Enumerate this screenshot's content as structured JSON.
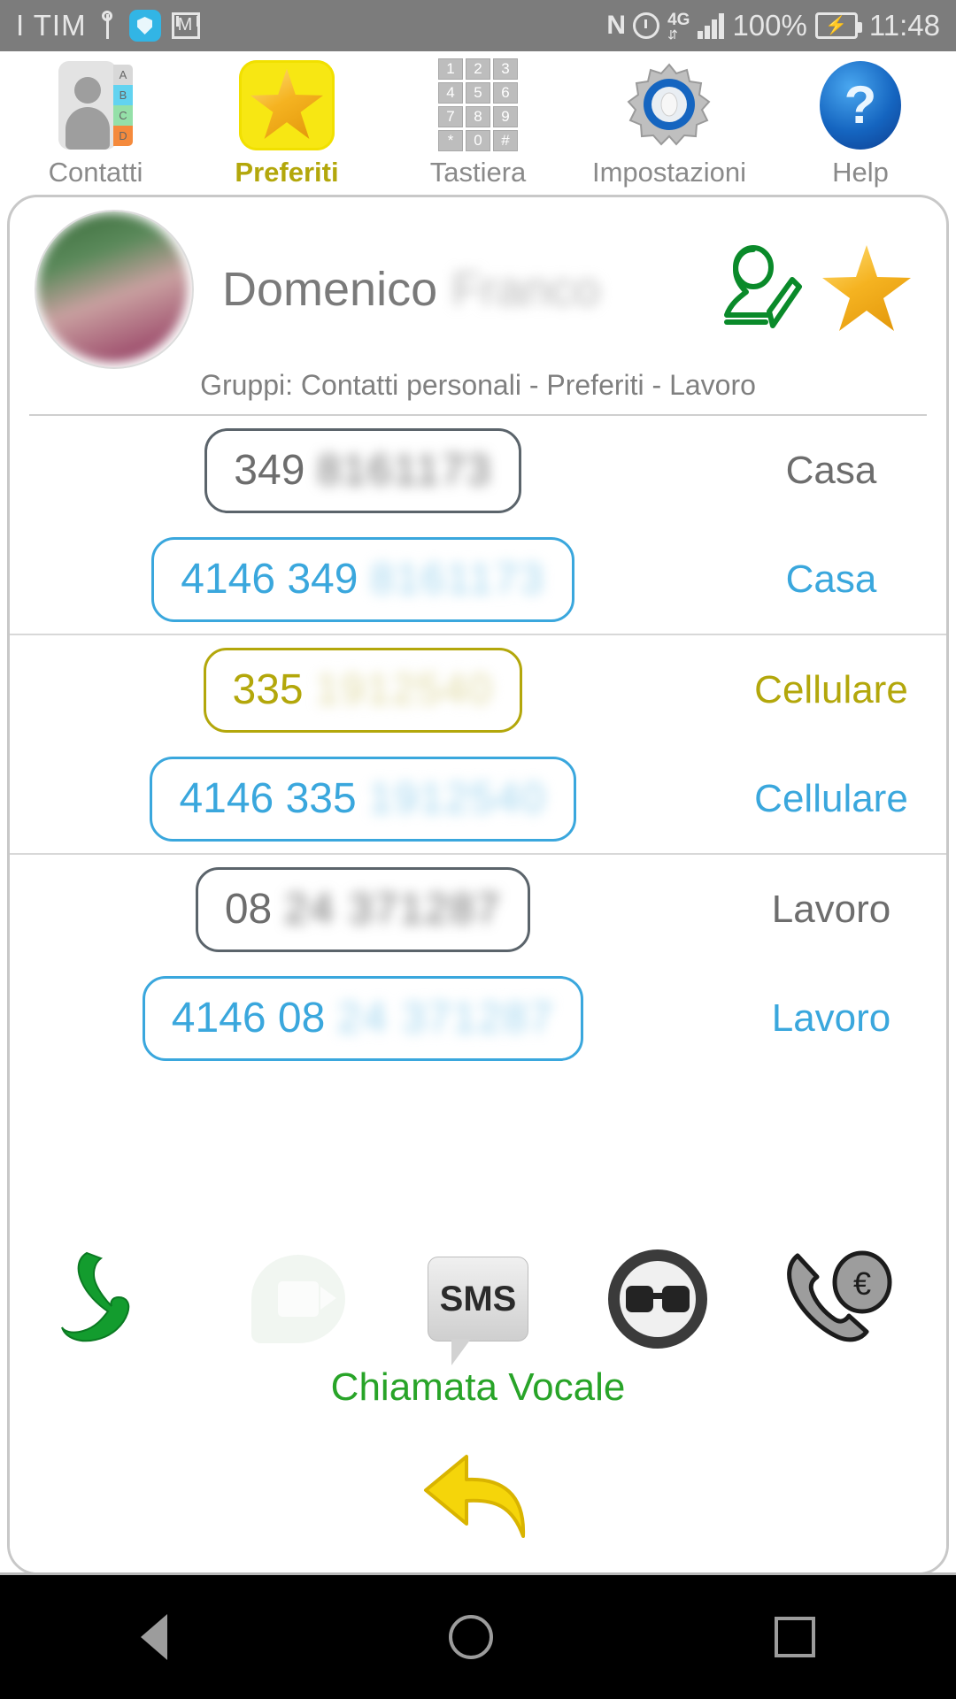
{
  "status_bar": {
    "carrier": "I TIM",
    "icons": [
      "usb-icon",
      "shield-icon",
      "mail-icon",
      "nfc-icon",
      "alarm-icon"
    ],
    "network_type": "4G",
    "battery_percent": "100%",
    "time": "11:48"
  },
  "tabs": [
    {
      "label": "Contatti",
      "icon": "contacts-book-icon",
      "active": false
    },
    {
      "label": "Preferiti",
      "icon": "gold-star-icon",
      "active": true
    },
    {
      "label": "Tastiera",
      "icon": "keypad-icon",
      "active": false
    },
    {
      "label": "Impostazioni",
      "icon": "gear-icon",
      "active": false
    },
    {
      "label": "Help",
      "icon": "question-mark-icon",
      "active": false
    }
  ],
  "keypad_icon_keys": [
    "1",
    "2",
    "3",
    "4",
    "5",
    "6",
    "7",
    "8",
    "9",
    "*",
    "0",
    "#"
  ],
  "contact": {
    "first_name": "Domenico",
    "last_name_masked": "Franco",
    "avatar": "contact-photo",
    "edit_icon": "edit-contact-icon",
    "favorite_icon": "gold-star-icon",
    "groups_line": "Gruppi: Contatti personali - Preferiti - Lavoro"
  },
  "phone_rows": [
    {
      "prefix": "349",
      "masked": "8161173",
      "label": "Casa",
      "style": "gray"
    },
    {
      "prefix": "4146 349",
      "masked": "8161173",
      "label": "Casa",
      "style": "blue"
    },
    {
      "prefix": "335",
      "masked": "1912540",
      "label": "Cellulare",
      "style": "olive"
    },
    {
      "prefix": "4146 335",
      "masked": "1912540",
      "label": "Cellulare",
      "style": "blue"
    },
    {
      "prefix": "08",
      "masked": "24 371287",
      "label": "Lavoro",
      "style": "gray"
    },
    {
      "prefix": "4146 08",
      "masked": "24 371287",
      "label": "Lavoro",
      "style": "blue"
    }
  ],
  "actions": [
    {
      "name": "voice-call-icon",
      "label": "",
      "enabled": true
    },
    {
      "name": "video-call-icon",
      "label": "",
      "enabled": false
    },
    {
      "name": "sms-icon",
      "label": "SMS",
      "enabled": true
    },
    {
      "name": "anonymous-call-icon",
      "label": "",
      "enabled": true
    },
    {
      "name": "paid-call-icon",
      "label": "€",
      "enabled": true
    }
  ],
  "action_caption": "Chiamata Vocale",
  "back_button": "back-arrow-icon",
  "navbar": [
    "nav-back-icon",
    "nav-home-icon",
    "nav-recents-icon"
  ],
  "colors": {
    "accent_blue": "#3aa7dd",
    "accent_olive": "#b3a70b",
    "accent_green": "#28a428",
    "status_bar_bg": "#7c7c7c",
    "text_gray": "#7a7a7a"
  }
}
